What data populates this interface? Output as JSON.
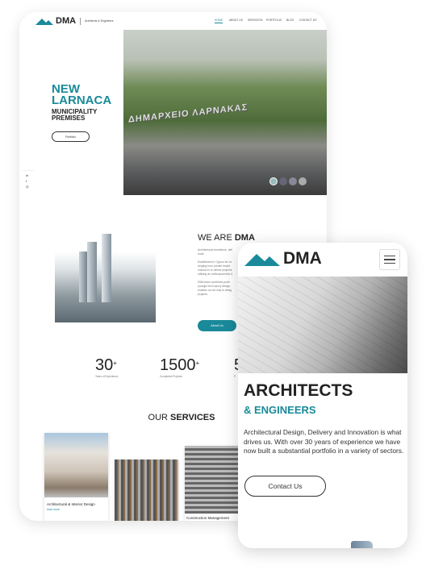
{
  "colors": {
    "accent": "#1a8a9a",
    "text": "#222222"
  },
  "desktop": {
    "logo": {
      "text": "DMA",
      "tagline": "Architects & Engineers"
    },
    "nav": [
      {
        "label": "HOME",
        "active": true
      },
      {
        "label": "ABOUT US"
      },
      {
        "label": "SERVICES",
        "has_dropdown": true
      },
      {
        "label": "PORTFOLIO"
      },
      {
        "label": "BLOG"
      },
      {
        "label": "CONTACT US"
      }
    ],
    "hero": {
      "title_line1": "NEW",
      "title_line2": "LARNACA",
      "subtitle_line1": "MUNICIPALITY",
      "subtitle_line2": "PREMISES",
      "button": "Portfolio",
      "image_sign": "ΔΗΜΑΡΧΕΙΟ ΛΑΡΝΑΚΑΣ",
      "slider_thumbs": 4
    },
    "social": [
      {
        "icon": "linkedin-icon",
        "glyph": "in"
      },
      {
        "icon": "facebook-icon",
        "glyph": "f"
      },
      {
        "icon": "instagram-icon",
        "glyph": "◎"
      }
    ],
    "about": {
      "title_regular": "WE ARE ",
      "title_bold": "DMA",
      "paragraphs": [
        [
          "Architectural excellence, deli",
          "most."
        ],
        [
          "Established in Cyprus for ov",
          "ranging from private reside",
          "mission is to deliver projects",
          "utilising an anthropocentric d"
        ],
        [
          "DMA team combines profe",
          "younger tech-savvy design",
          "enables us not only to desig",
          "projects."
        ]
      ],
      "button": "About Us"
    },
    "stats": [
      {
        "value": "30",
        "suffix": "+",
        "label": "Years of Experience"
      },
      {
        "value": "1500",
        "suffix": "+",
        "label": "Completed Projects"
      },
      {
        "value": "5",
        "suffix": "",
        "label": "P"
      }
    ],
    "services": {
      "title_regular": "OUR ",
      "title_bold": "SERVICES",
      "cards": [
        {
          "title": "Architectural & Interior Design",
          "link": "read more"
        },
        {
          "title": "",
          "link": ""
        },
        {
          "title": "Construction Management",
          "link": ""
        }
      ]
    }
  },
  "mobile": {
    "logo": {
      "text": "DMA"
    },
    "menu_icon": "hamburger-icon",
    "hero": {
      "title": "ARCHITECTS",
      "subtitle": "& ENGINEERS",
      "text": "Architectural Design, Delivery and Innovation is what drives us. With over 30 years of experience we have now built a substantial portfolio in a variety of sectors.",
      "button": "Contact Us"
    }
  }
}
